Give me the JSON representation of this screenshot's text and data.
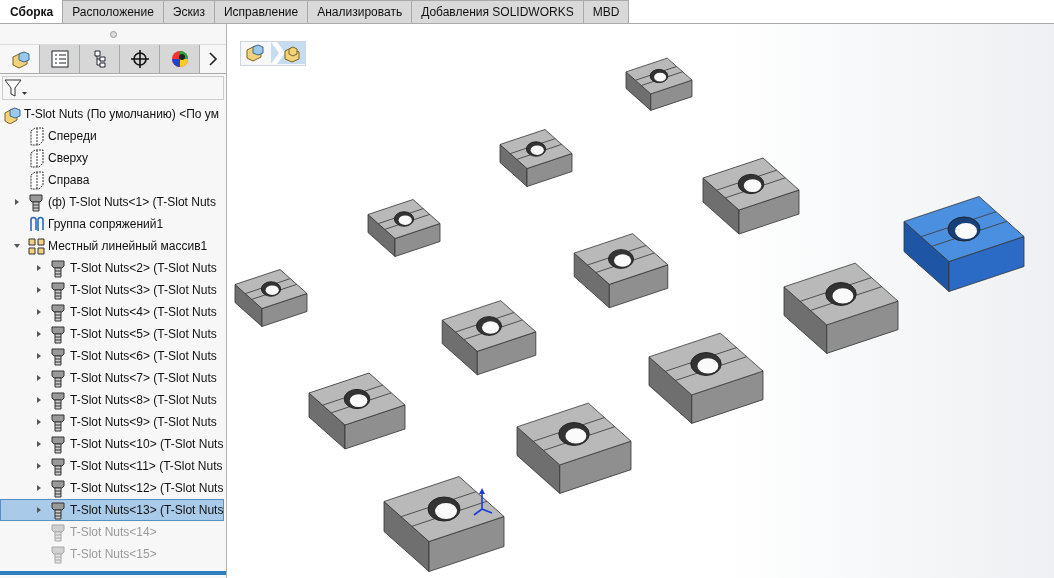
{
  "command_tabs": [
    {
      "label": "Сборка",
      "selected": true
    },
    {
      "label": "Расположение",
      "selected": false
    },
    {
      "label": "Эскиз",
      "selected": false
    },
    {
      "label": "Исправление",
      "selected": false
    },
    {
      "label": "Анализировать",
      "selected": false
    },
    {
      "label": "Добавления SOLIDWORKS",
      "selected": false
    },
    {
      "label": "MBD",
      "selected": false
    }
  ],
  "panel_tabs": [
    {
      "kind": "feature",
      "selected": true
    },
    {
      "kind": "property",
      "selected": false
    },
    {
      "kind": "config",
      "selected": false
    },
    {
      "kind": "dim",
      "selected": false
    },
    {
      "kind": "display",
      "selected": false
    }
  ],
  "tree": {
    "label": "T-Slot Nuts (По умолчанию) <По ум",
    "kind": "assembly",
    "children": [
      {
        "label": "Спереди",
        "kind": "plane"
      },
      {
        "label": "Сверху",
        "kind": "plane"
      },
      {
        "label": "Справа",
        "kind": "plane"
      },
      {
        "label": "(ф) T-Slot Nuts<1> (T-Slot Nuts",
        "kind": "part",
        "expanded": false,
        "selected": false
      },
      {
        "label": "Группа сопряжений1",
        "kind": "mates"
      },
      {
        "label": "Местный линейный массив1",
        "kind": "pattern",
        "expanded": true,
        "children": [
          {
            "label": "T-Slot Nuts<2> (T-Slot Nuts",
            "kind": "part",
            "expanded": false,
            "selected": false,
            "suppressed": false
          },
          {
            "label": "T-Slot Nuts<3> (T-Slot Nuts",
            "kind": "part",
            "expanded": false,
            "selected": false,
            "suppressed": false
          },
          {
            "label": "T-Slot Nuts<4> (T-Slot Nuts",
            "kind": "part",
            "expanded": false,
            "selected": false,
            "suppressed": false
          },
          {
            "label": "T-Slot Nuts<5> (T-Slot Nuts",
            "kind": "part",
            "expanded": false,
            "selected": false,
            "suppressed": false
          },
          {
            "label": "T-Slot Nuts<6> (T-Slot Nuts",
            "kind": "part",
            "expanded": false,
            "selected": false,
            "suppressed": false
          },
          {
            "label": "T-Slot Nuts<7> (T-Slot Nuts",
            "kind": "part",
            "expanded": false,
            "selected": false,
            "suppressed": false
          },
          {
            "label": "T-Slot Nuts<8> (T-Slot Nuts",
            "kind": "part",
            "expanded": false,
            "selected": false,
            "suppressed": false
          },
          {
            "label": "T-Slot Nuts<9> (T-Slot Nuts",
            "kind": "part",
            "expanded": false,
            "selected": false,
            "suppressed": false
          },
          {
            "label": "T-Slot Nuts<10> (T-Slot Nuts",
            "kind": "part",
            "expanded": false,
            "selected": false,
            "suppressed": false
          },
          {
            "label": "T-Slot Nuts<11> (T-Slot Nuts",
            "kind": "part",
            "expanded": false,
            "selected": false,
            "suppressed": false
          },
          {
            "label": "T-Slot Nuts<12> (T-Slot Nuts",
            "kind": "part",
            "expanded": false,
            "selected": false,
            "suppressed": false
          },
          {
            "label": "T-Slot Nuts<13> (T-Slot Nuts",
            "kind": "part",
            "expanded": false,
            "selected": true,
            "suppressed": false
          },
          {
            "label": "T-Slot Nuts<14>",
            "kind": "part",
            "selected": false,
            "suppressed": true
          },
          {
            "label": "T-Slot Nuts<15>",
            "kind": "part",
            "selected": false,
            "suppressed": true
          }
        ]
      }
    ]
  },
  "viewport": {
    "parts": [
      {
        "selected": false
      },
      {
        "selected": false
      },
      {
        "selected": false
      },
      {
        "selected": false
      },
      {
        "selected": false
      },
      {
        "selected": false
      },
      {
        "selected": false
      },
      {
        "selected": false
      },
      {
        "selected": true
      },
      {
        "selected": false
      },
      {
        "selected": false
      },
      {
        "selected": false
      },
      {
        "selected": false
      }
    ]
  }
}
